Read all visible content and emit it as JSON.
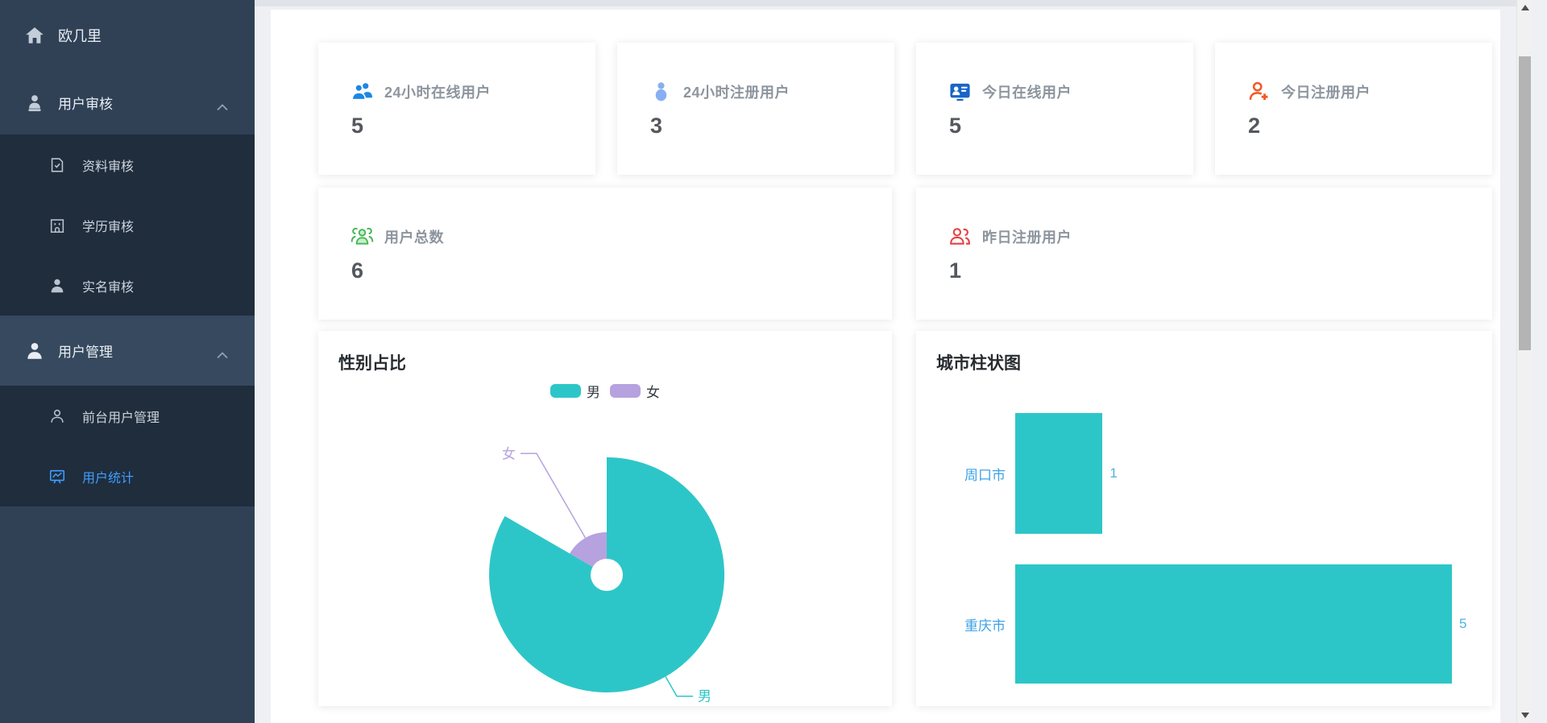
{
  "app": {
    "title": "欧几里"
  },
  "sidebar": {
    "colors": {
      "bg": "#304156",
      "submenu_bg": "#1f2d3d",
      "active_text": "#409eff"
    },
    "items": [
      {
        "label": "欧几里",
        "icon": "home-icon"
      },
      {
        "label": "用户审核",
        "icon": "user-badge-icon",
        "expanded": true
      },
      {
        "label": "资料审核",
        "icon": "document-check-icon"
      },
      {
        "label": "学历审核",
        "icon": "school-building-icon"
      },
      {
        "label": "实名审核",
        "icon": "user-filled-icon"
      },
      {
        "label": "用户管理",
        "icon": "user-filled-icon",
        "expanded": true
      },
      {
        "label": "前台用户管理",
        "icon": "user-outline-icon"
      },
      {
        "label": "用户统计",
        "icon": "chart-board-icon",
        "active": true
      }
    ]
  },
  "stats": {
    "row1": [
      {
        "label": "24小时在线用户",
        "value": "5",
        "icon": "users-filled-icon",
        "icon_color": "#1b87e6"
      },
      {
        "label": "24小时注册用户",
        "value": "3",
        "icon": "user-filled-icon",
        "icon_color": "#88aff2"
      },
      {
        "label": "今日在线用户",
        "value": "5",
        "icon": "id-card-icon",
        "icon_color": "#1a64c8"
      },
      {
        "label": "今日注册用户",
        "value": "2",
        "icon": "user-plus-icon",
        "icon_color": "#f05a28"
      }
    ],
    "row2": [
      {
        "label": "用户总数",
        "value": "6",
        "icon": "users-group-icon",
        "icon_color": "#43b854"
      },
      {
        "label": "昨日注册用户",
        "value": "1",
        "icon": "users-outline-icon",
        "icon_color": "#e84040"
      }
    ]
  },
  "chart_data": [
    {
      "type": "pie",
      "style": "rose",
      "title": "性别占比",
      "legend": [
        "男",
        "女"
      ],
      "legend_position": "top-center",
      "series": [
        {
          "name": "男",
          "value": 5,
          "color": "#2dc6c8"
        },
        {
          "name": "女",
          "value": 1,
          "color": "#b6a2de"
        }
      ]
    },
    {
      "type": "bar",
      "orientation": "horizontal",
      "title": "城市柱状图",
      "categories": [
        "周口市",
        "重庆市"
      ],
      "values": [
        1,
        5
      ],
      "xlim": [
        0,
        5
      ],
      "bar_color": "#2dc6c8",
      "category_label_color": "#3da2e6",
      "value_label_color": "#4db2e6"
    }
  ]
}
